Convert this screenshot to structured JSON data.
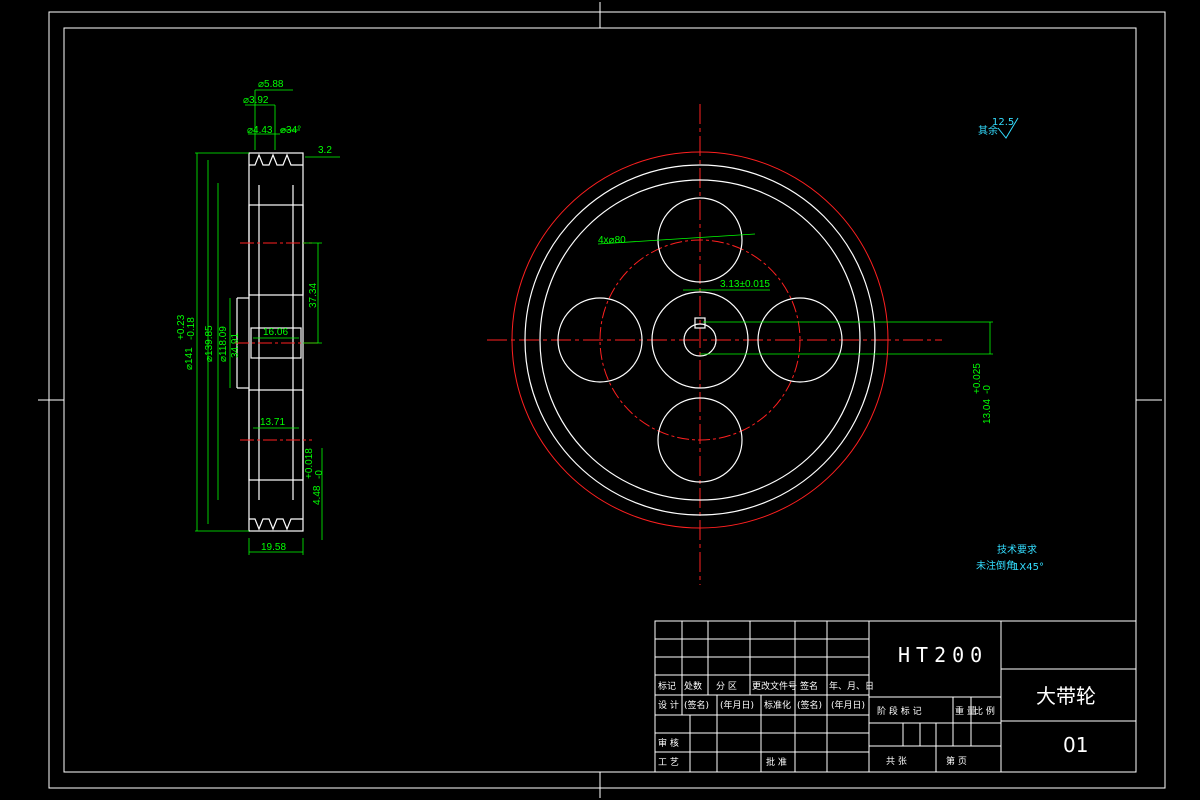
{
  "colors": {
    "background": "#000000",
    "outline": "#ffffff",
    "centerline": "#ff2020",
    "dimension": "#00ff00",
    "note": "#33ddff"
  },
  "side_view": {
    "dims": {
      "top1": "⌀5.88",
      "top2": "⌀3.92",
      "top3": "⌀4.43",
      "angle": "⌀34°",
      "outer": "⌀141",
      "tol_hi": "+0.23",
      "tol_lo": "-0.18",
      "d2": "⌀139.85",
      "d3": "⌀118.09",
      "d4": "34.91",
      "hub_w": "16.06",
      "web_h": "37.34",
      "b2": "13.71",
      "keyway": "4.48",
      "keyway_tol_hi": "+0.018",
      "keyway_tol_lo": "-0",
      "width": "19.58"
    },
    "rough_mark": "3.2"
  },
  "front_view": {
    "hole_callout": "4x⌀80",
    "key_width": "3.13±0.015",
    "key_depth": "13.04",
    "key_depth_tol_hi": "+0.025",
    "key_depth_tol_lo": "-0"
  },
  "roughness_note": {
    "label": "其余",
    "value": "12.5"
  },
  "tech_notes": {
    "title": "技术要求",
    "line1_prefix": "未注倒角",
    "line1_value": "1X45°"
  },
  "title_block": {
    "material": "HT200",
    "part_name": "大带轮",
    "drawing_no": "01",
    "row_labels_1": [
      "标记",
      "处数",
      "分 区",
      "更改文件号",
      "签名",
      "年、月、日"
    ],
    "row_labels_2": [
      "设 计",
      "(签名)",
      "(年月日)",
      "标准化",
      "(签名)",
      "(年月日)"
    ],
    "row_labels_3": [
      "审 核"
    ],
    "row_labels_4": [
      "工 艺",
      "批 准"
    ],
    "stage_labels": [
      "阶 段 标 记",
      "重 量",
      "比 例"
    ],
    "sheet_labels": [
      "共 张",
      "第 页"
    ]
  }
}
